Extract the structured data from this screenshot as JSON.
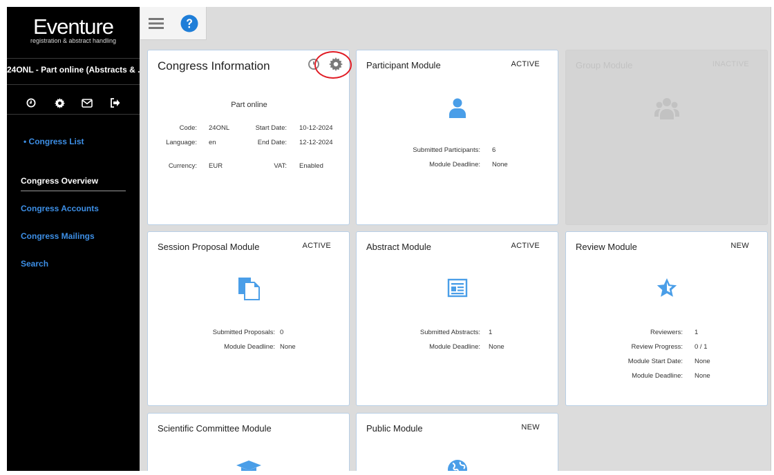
{
  "sidebar": {
    "logo_main": "Eventure",
    "logo_sub": "registration & abstract handling",
    "congress_name": "24ONL - Part online (Abstracts & ...",
    "icons": [
      "clock-icon",
      "gear-icon",
      "envelope-icon",
      "sign-out-icon"
    ],
    "congress_list_link": "• Congress List",
    "nav": {
      "overview": "Congress Overview",
      "accounts": "Congress Accounts",
      "mailings": "Congress Mailings",
      "search": "Search"
    }
  },
  "toolbar": {
    "icons": [
      "hamburger-icon",
      "help-icon"
    ]
  },
  "cards": {
    "congress_info": {
      "title": "Congress Information",
      "subtitle": "Part online",
      "code_label": "Code:",
      "code": "24ONL",
      "language_label": "Language:",
      "language": "en",
      "currency_label": "Currency:",
      "currency": "EUR",
      "start_label": "Start Date:",
      "start": "10-12-2024",
      "end_label": "End Date:",
      "end": "12-12-2024",
      "vat_label": "VAT:",
      "vat": "Enabled"
    },
    "participant": {
      "title": "Participant Module",
      "status": "ACTIVE",
      "l1": "Submitted Participants:",
      "v1": "6",
      "l2": "Module Deadline:",
      "v2": "None"
    },
    "group": {
      "title": "Group Module",
      "status": "INACTIVE"
    },
    "session": {
      "title": "Session Proposal Module",
      "status": "ACTIVE",
      "l1": "Submitted Proposals:",
      "v1": "0",
      "l2": "Module Deadline:",
      "v2": "None"
    },
    "abstract": {
      "title": "Abstract Module",
      "status": "ACTIVE",
      "l1": "Submitted Abstracts:",
      "v1": "1",
      "l2": "Module Deadline:",
      "v2": "None"
    },
    "review": {
      "title": "Review Module",
      "status": "NEW",
      "l1": "Reviewers:",
      "v1": "1",
      "l2": "Review Progress:",
      "v2": "0 / 1",
      "l3": "Module Start Date:",
      "v3": "None",
      "l4": "Module Deadline:",
      "v4": "None"
    },
    "scientific": {
      "title": "Scientific Committee Module"
    },
    "public": {
      "title": "Public Module",
      "status": "NEW"
    }
  },
  "colors": {
    "accent": "#3d8fe6",
    "icon_blue": "#4a9ee8",
    "highlight": "#e01b24",
    "sidebar": "#000000"
  }
}
